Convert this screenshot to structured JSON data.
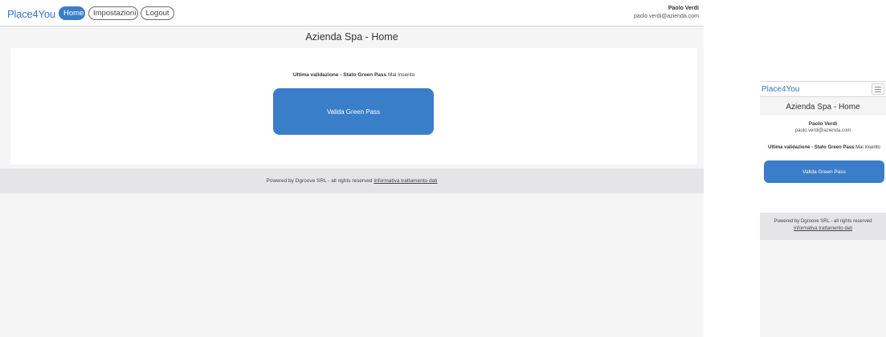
{
  "app": {
    "brand": "Place4You"
  },
  "nav": {
    "home": "Home",
    "settings": "Impostazioni",
    "logout": "Logout"
  },
  "user": {
    "name": "Paolo Verdi",
    "email": "paolo.verdi@azienda.com"
  },
  "page": {
    "title": "Azienda Spa - Home"
  },
  "status": {
    "label": "Ultima validazione - Stato Green Pass",
    "value": "Mai inserito"
  },
  "actions": {
    "validate": "Valida Green Pass"
  },
  "footer": {
    "text": "Powered by Dgroove SRL - all rights reserved",
    "link": "Informativa trattamento dati"
  },
  "colors": {
    "accent": "#3a7dc9",
    "brand": "#3578c7",
    "background": "#f5f5f6",
    "footer_bg": "#e5e5e7"
  },
  "icons": {
    "menu": "hamburger-icon"
  }
}
